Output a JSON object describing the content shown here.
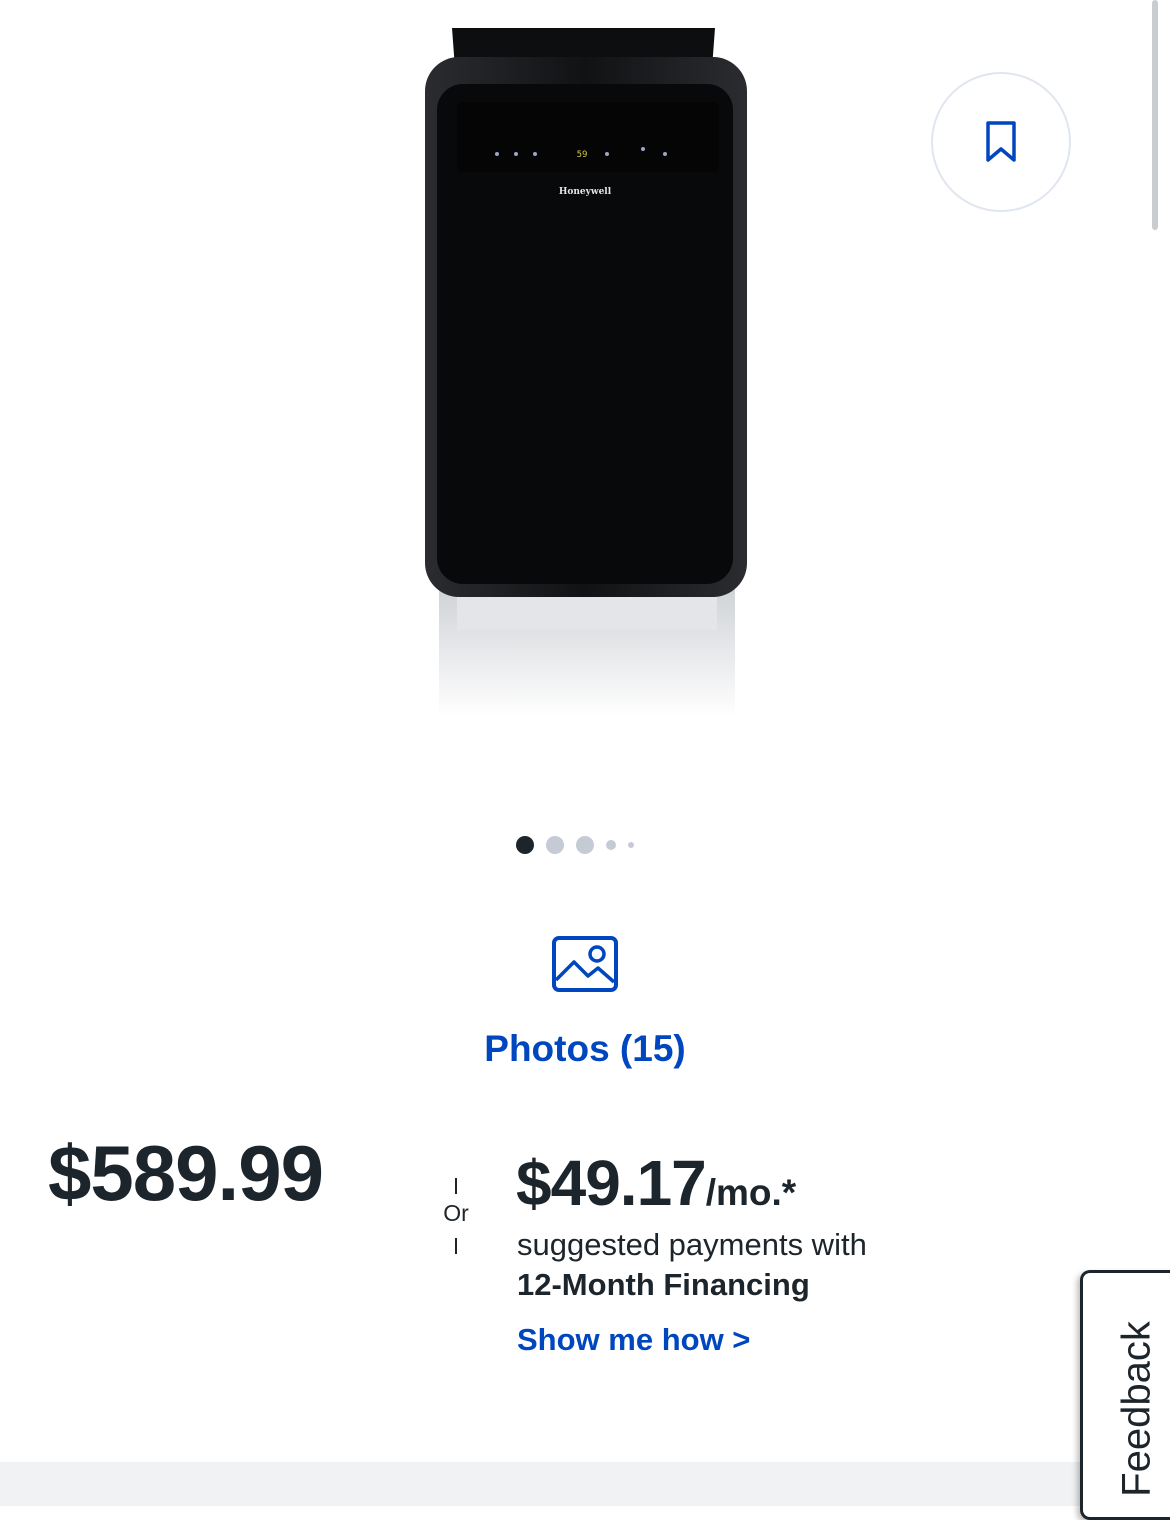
{
  "product": {
    "image_alt": "Honeywell portable air conditioner",
    "brand_logo": "Honeywell",
    "display_reading": "59"
  },
  "save": {
    "icon": "bookmark-icon"
  },
  "carousel": {
    "count": 5,
    "active_index": 0
  },
  "photos": {
    "icon": "image-icon",
    "label": "Photos (15)"
  },
  "pricing": {
    "price": "$589.99",
    "or_label": "Or",
    "monthly_amount": "$49.17",
    "monthly_suffix": "/mo.*",
    "financing_line1": "suggested payments with",
    "financing_line2": "12-Month Financing",
    "show_me_link": "Show me how >"
  },
  "feedback": {
    "label": "Feedback"
  },
  "colors": {
    "text": "#1d252c",
    "link_blue": "#0046be",
    "dot_inactive": "#c5cbd5",
    "save_border": "#e0e6ef"
  }
}
